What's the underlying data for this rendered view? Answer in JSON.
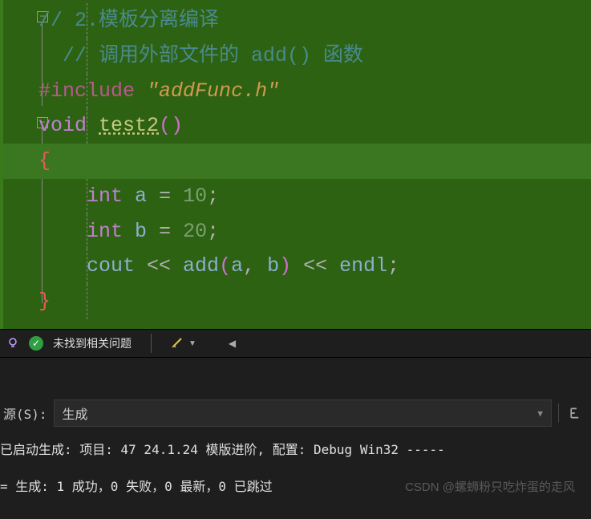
{
  "code": {
    "comment1": "// 2.模板分离编译",
    "comment2": "// 调用外部文件的 add() 函数",
    "include_directive": "#include",
    "include_file": "\"addFunc.h\"",
    "void_kw": "void",
    "func_name": "test2",
    "open_paren": "(",
    "close_paren": ")",
    "open_brace": "{",
    "close_brace": "}",
    "int_kw": "int",
    "var_a": "a",
    "var_b": "b",
    "eq": " = ",
    "val_a": "10",
    "val_b": "20",
    "semi": ";",
    "cout": "cout",
    "ins": " << ",
    "add_call": "add",
    "comma": ", ",
    "endl": "endl"
  },
  "issues": {
    "status": "未找到相关问题"
  },
  "output": {
    "filter_label": "源(S):",
    "filter_value": "生成",
    "line1": "已启动生成: 项目: 47 24.1.24 模版进阶, 配置: Debug Win32 -----",
    "line2": "= 生成: 1 成功，0 失败，0 最新，0 已跳过"
  },
  "watermark": "CSDN @螺蛳粉只吃炸蛋的走风"
}
